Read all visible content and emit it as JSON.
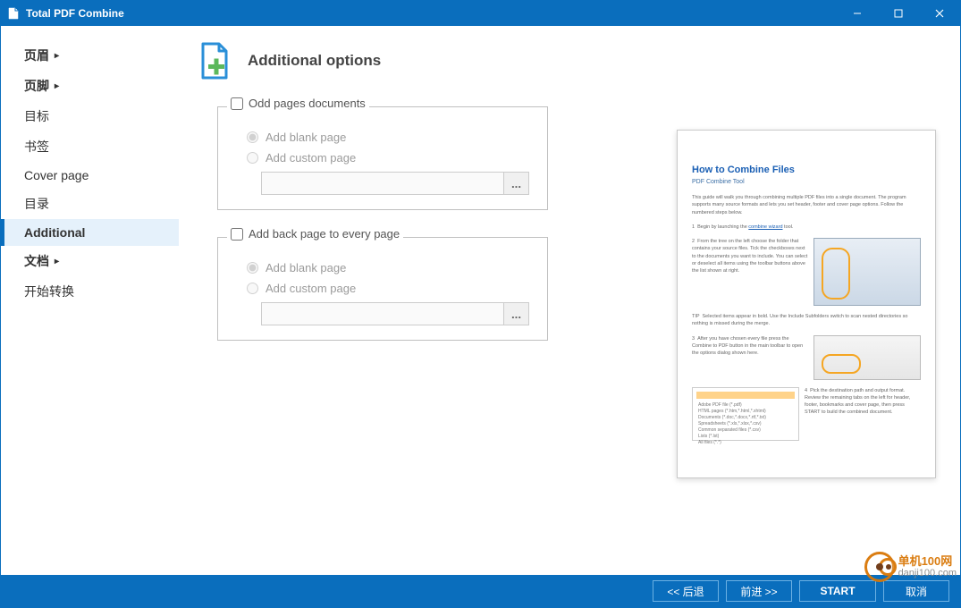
{
  "window": {
    "title": "Total PDF Combine"
  },
  "sidebar": {
    "items": [
      {
        "label": "页眉",
        "bold": true,
        "arrow": true
      },
      {
        "label": "页脚",
        "bold": true,
        "arrow": true
      },
      {
        "label": "目标",
        "bold": false,
        "arrow": false
      },
      {
        "label": "书签",
        "bold": false,
        "arrow": false
      },
      {
        "label": "Cover page",
        "bold": false,
        "arrow": false
      },
      {
        "label": "目录",
        "bold": false,
        "arrow": false
      },
      {
        "label": "Additional",
        "bold": true,
        "arrow": false,
        "selected": true
      },
      {
        "label": "文档",
        "bold": true,
        "arrow": true
      },
      {
        "label": "开始转换",
        "bold": false,
        "arrow": false
      }
    ]
  },
  "header": {
    "title": "Additional options"
  },
  "group1": {
    "legend": "Odd pages documents",
    "radio_blank": "Add blank page",
    "radio_custom": "Add custom page",
    "browse": "..."
  },
  "group2": {
    "legend": "Add back page to every page",
    "radio_blank": "Add blank page",
    "radio_custom": "Add custom page",
    "browse": "..."
  },
  "preview": {
    "title": "How to Combine Files",
    "subtitle": "PDF Combine Tool"
  },
  "footer": {
    "back": "<<  后退",
    "forward": "前进  >>",
    "start": "START",
    "cancel": "取消"
  },
  "watermark": {
    "name": "单机100网",
    "domain": "danji100.com"
  }
}
